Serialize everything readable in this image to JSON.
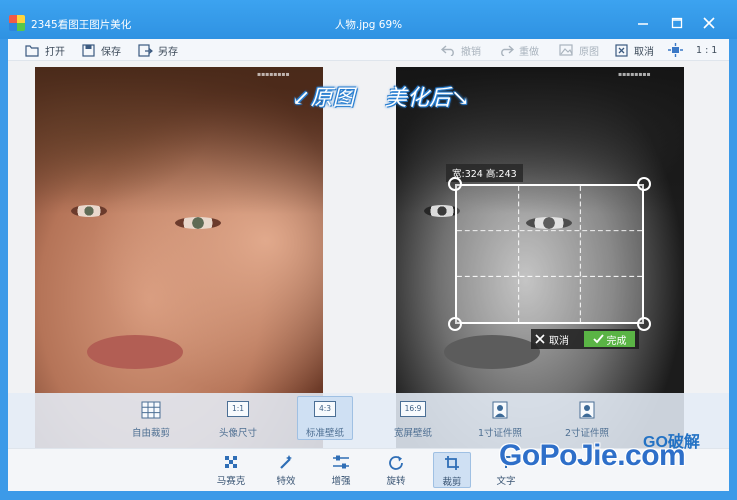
{
  "window": {
    "app_title": "2345看图王图片美化",
    "file_title": "人物.jpg  69%"
  },
  "toolbar": {
    "open": "打开",
    "save": "保存",
    "save_as": "另存",
    "undo": "撤销",
    "redo": "重做",
    "original": "原图",
    "cancel": "取消",
    "ratio": "1 : 1"
  },
  "canvas": {
    "label_original": "原图",
    "label_after": "美化后",
    "crop_dimensions": "宽:324  高:243",
    "crop_cancel": "取消",
    "crop_done": "完成"
  },
  "presets": [
    {
      "label": "自由裁剪",
      "icon": "grid-icon",
      "badge": ""
    },
    {
      "label": "头像尺寸",
      "icon": "ratio-icon",
      "badge": "1:1"
    },
    {
      "label": "标准壁纸",
      "icon": "ratio-icon",
      "badge": "4:3"
    },
    {
      "label": "宽屏壁纸",
      "icon": "ratio-icon",
      "badge": "16:9"
    },
    {
      "label": "1寸证件照",
      "icon": "id-photo-icon",
      "badge": ""
    },
    {
      "label": "2寸证件照",
      "icon": "id-photo-icon",
      "badge": ""
    }
  ],
  "presets_active_index": 2,
  "tools": [
    {
      "label": "马赛克",
      "icon": "mosaic-icon"
    },
    {
      "label": "特效",
      "icon": "magic-wand-icon"
    },
    {
      "label": "增强",
      "icon": "sliders-icon"
    },
    {
      "label": "旋转",
      "icon": "rotate-icon"
    },
    {
      "label": "裁剪",
      "icon": "crop-icon"
    },
    {
      "label": "文字",
      "icon": "text-icon"
    }
  ],
  "tools_active_index": 4,
  "brand": {
    "small": "GO破解",
    "big": "GoPoJie.com"
  },
  "colors": {
    "window_frame": "#3c9ae8",
    "accent": "#2f92e2",
    "done_green": "#5ab445",
    "active_bg": "#cfe0f3"
  }
}
